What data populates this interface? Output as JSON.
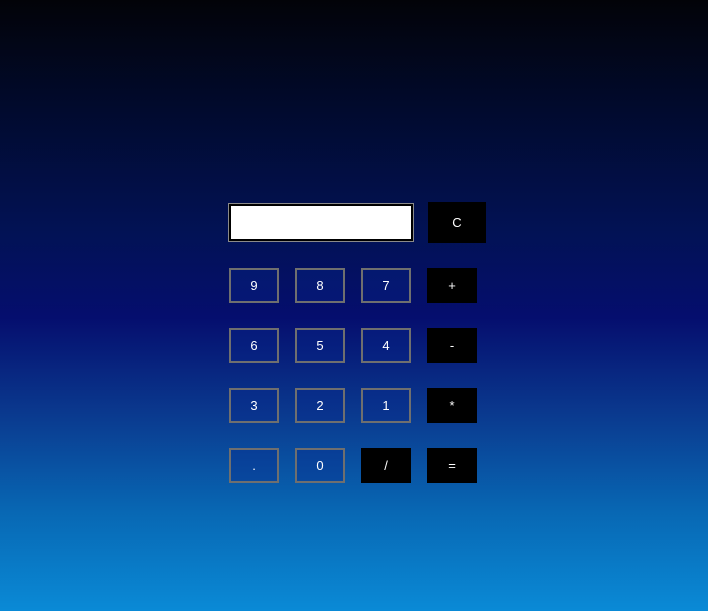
{
  "display": {
    "value": ""
  },
  "buttons": {
    "clear": "C",
    "n9": "9",
    "n8": "8",
    "n7": "7",
    "plus": "+",
    "n6": "6",
    "n5": "5",
    "n4": "4",
    "minus": "-",
    "n3": "3",
    "n2": "2",
    "n1": "1",
    "multiply": "*",
    "dot": ".",
    "n0": "0",
    "divide": "/",
    "equals": "="
  },
  "colors": {
    "operator_bg": "#000000",
    "number_border": "#6f6f6f",
    "display_bg": "#ffffff",
    "text": "#ffffff"
  }
}
